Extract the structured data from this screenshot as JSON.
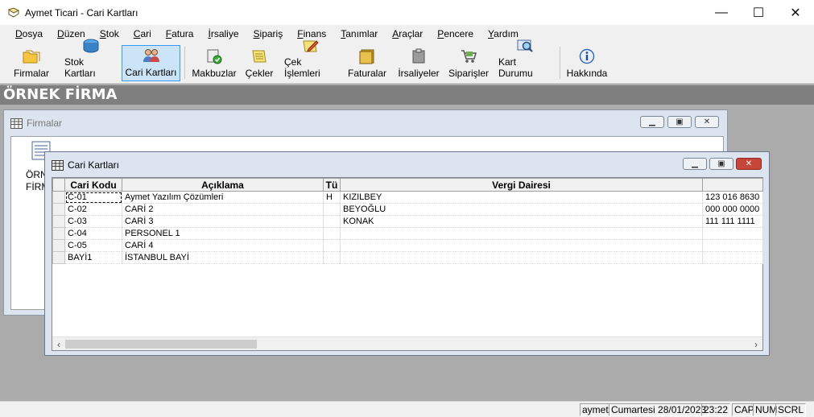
{
  "window": {
    "title": "Aymet Ticari - Cari Kartları",
    "minimize": "—",
    "maximize": "☐",
    "close": "✕"
  },
  "menu": [
    "Dosya",
    "Düzen",
    "Stok",
    "Cari",
    "Fatura",
    "İrsaliye",
    "Sipariş",
    "Finans",
    "Tanımlar",
    "Araçlar",
    "Pencere",
    "Yardım"
  ],
  "toolbar": {
    "firmalar": "Firmalar",
    "stok": "Stok Kartları",
    "cari": "Cari Kartları",
    "makbuzlar": "Makbuzlar",
    "cekler": "Çekler",
    "cek_islemleri": "Çek İşlemleri",
    "faturalar": "Faturalar",
    "irsaliyeler": "İrsaliyeler",
    "siparisler": "Siparişler",
    "kart_durumu": "Kart Durumu",
    "hakkinda": "Hakkında"
  },
  "firm_name": "ÖRNEK FİRMA",
  "firmalar_window": {
    "title": "Firmalar",
    "item_label_1": "ÖRN",
    "item_label_2": "FİRM"
  },
  "cari_window": {
    "title": "Cari Kartları",
    "columns": [
      "Cari Kodu",
      "Açıklama",
      "Tü",
      "Vergi Dairesi",
      ""
    ],
    "rows": [
      [
        "C-01",
        "Aymet Yazılım Çözümleri",
        "H",
        "KIZILBEY",
        "123 016 8630"
      ],
      [
        "C-02",
        "CARİ 2",
        "",
        "BEYOĞLU",
        "000 000 0000"
      ],
      [
        "C-03",
        "CARİ 3",
        "",
        "KONAK",
        "111 111 1111"
      ],
      [
        "C-04",
        "PERSONEL 1",
        "",
        "",
        ""
      ],
      [
        "C-05",
        "CARİ 4",
        "",
        "",
        ""
      ],
      [
        "BAYİ1",
        "İSTANBUL BAYİ",
        "",
        "",
        ""
      ]
    ]
  },
  "statusbar": {
    "user": "aymet",
    "date": "Cumartesi 28/01/2023",
    "time": "23:22",
    "cap": "CAP",
    "num": "NUM",
    "scrl": "SCRL"
  }
}
